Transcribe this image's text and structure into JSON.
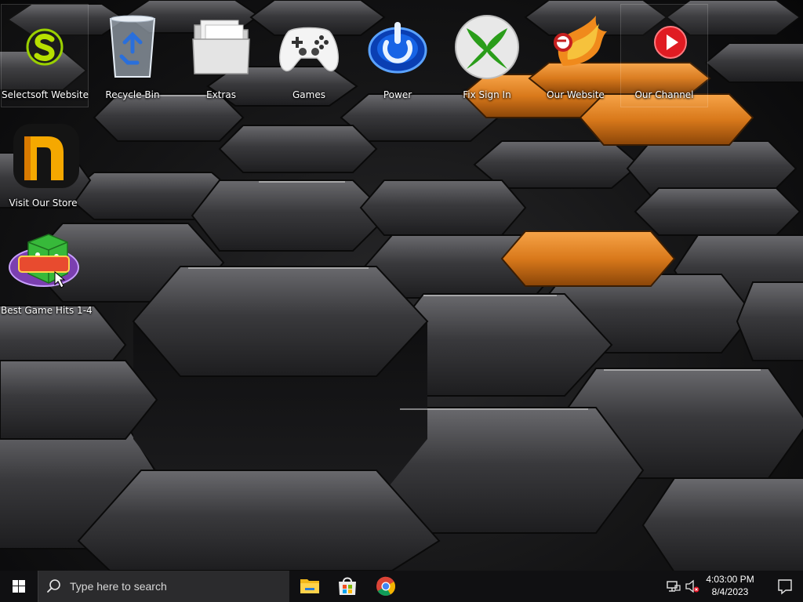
{
  "desktop": {
    "icons": [
      {
        "label": "Selectsoft Website",
        "icon": "selectsoft-logo-icon"
      },
      {
        "label": "Recycle Bin",
        "icon": "recycle-bin-icon"
      },
      {
        "label": "Extras",
        "icon": "folder-icon"
      },
      {
        "label": "Games",
        "icon": "game-controller-icon"
      },
      {
        "label": "Power",
        "icon": "power-icon"
      },
      {
        "label": "Fix Sign In",
        "icon": "xbox-icon"
      },
      {
        "label": "Our Website",
        "icon": "phoenix-icon"
      },
      {
        "label": "Our Channel",
        "icon": "play-button-icon"
      },
      {
        "label": "Visit Our Store",
        "icon": "store-n-logo-icon"
      },
      {
        "label": "Best Game Hits 1-4",
        "icon": "game-dice-icon"
      }
    ],
    "selected_icons": [
      "Selectsoft Website",
      "Our Channel"
    ]
  },
  "taskbar": {
    "search_placeholder": "Type here to search",
    "pinned_apps": [
      "file-explorer-icon",
      "microsoft-store-icon",
      "chrome-icon"
    ],
    "tray_icons": [
      "network-icon",
      "volume-muted-icon"
    ],
    "clock": {
      "time": "4:03:00 PM",
      "date": "8/4/2023"
    }
  },
  "colors": {
    "accent_orange": "#e8861a",
    "taskbar_bg": "#101012",
    "search_bg": "#2b2b2d"
  }
}
